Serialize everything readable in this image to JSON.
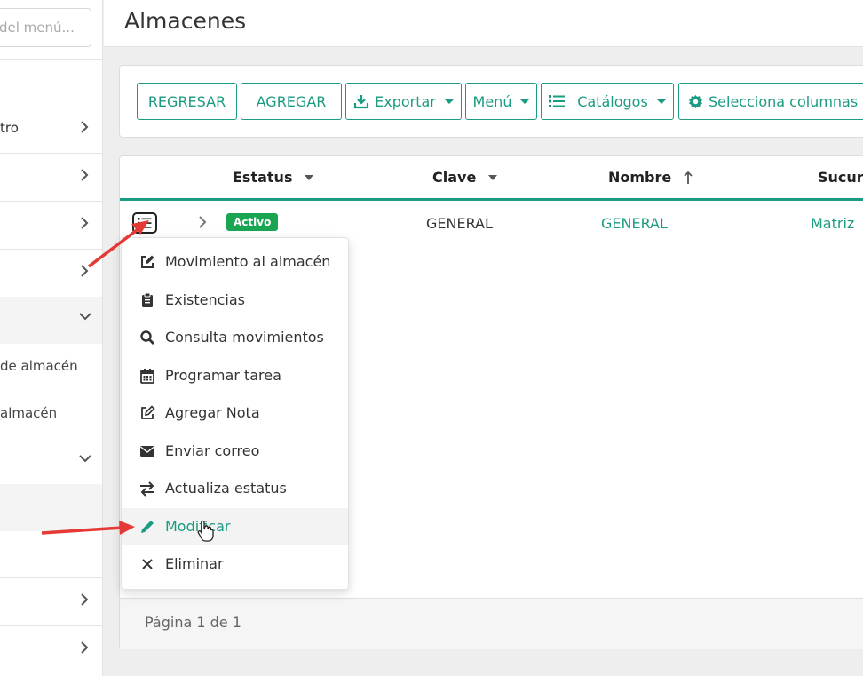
{
  "sidebar": {
    "search_placeholder": "del menú...",
    "items": [
      {
        "label": "tro"
      },
      {
        "label": ""
      },
      {
        "label": ""
      },
      {
        "label": ""
      },
      {
        "label": ""
      }
    ],
    "subitems": [
      {
        "label": "de almacén"
      },
      {
        "label": " almacén"
      }
    ]
  },
  "header": {
    "title": "Almacenes"
  },
  "toolbar": {
    "back_label": "REGRESAR",
    "add_label": "AGREGAR",
    "export_label": "Exportar",
    "menu_label": "Menú",
    "catalogs_label": "Catálogos",
    "columns_label": "Selecciona columnas"
  },
  "table": {
    "columns": [
      "Estatus",
      "Clave",
      "Nombre",
      "Sucurs"
    ],
    "rows": [
      {
        "estatus": "Activo",
        "clave": "GENERAL",
        "nombre": "GENERAL",
        "sucursal": "Matriz"
      }
    ],
    "pager": "Página 1 de 1"
  },
  "row_menu": {
    "items": [
      {
        "label": "Movimiento al almacén",
        "icon": "edit-square-icon"
      },
      {
        "label": "Existencias",
        "icon": "clipboard-icon"
      },
      {
        "label": "Consulta movimientos",
        "icon": "search-icon"
      },
      {
        "label": "Programar tarea",
        "icon": "calendar-icon"
      },
      {
        "label": "Agregar Nota",
        "icon": "note-edit-icon"
      },
      {
        "label": "Enviar correo",
        "icon": "envelope-icon"
      },
      {
        "label": "Actualiza estatus",
        "icon": "exchange-arrows-icon"
      },
      {
        "label": "Modificar",
        "icon": "pencil-icon"
      },
      {
        "label": "Eliminar",
        "icon": "close-icon"
      }
    ]
  },
  "colors": {
    "accent": "#1b9b82",
    "status_active": "#1aa552",
    "annotation_arrow": "#e53935"
  }
}
